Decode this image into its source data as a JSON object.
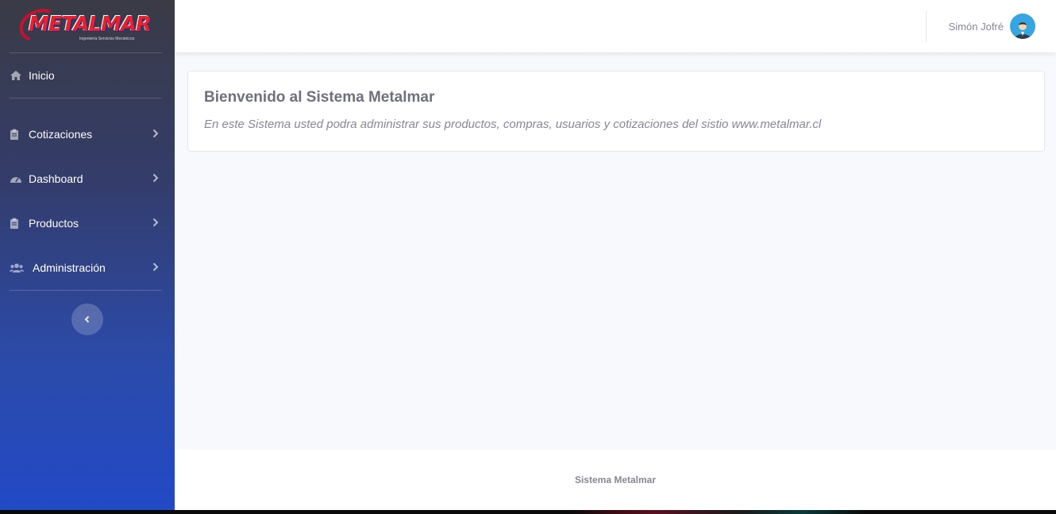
{
  "brand": {
    "logo_text": "METALMAR",
    "logo_subtitle": "Ingeniería Servicios Mecánicos"
  },
  "sidebar": {
    "items": [
      {
        "label": "Inicio",
        "icon": "home-icon"
      },
      {
        "label": "Cotizaciones",
        "icon": "clipboard-icon"
      },
      {
        "label": "Dashboard",
        "icon": "tachometer-icon"
      },
      {
        "label": "Productos",
        "icon": "clipboard-icon"
      },
      {
        "label": "Administración",
        "icon": "users-icon"
      }
    ],
    "toggle_icon": "chevron-left-icon"
  },
  "topbar": {
    "user_name": "Simón Jofré",
    "avatar_icon": "user-avatar-icon"
  },
  "main": {
    "title": "Bienvenido al Sistema Metalmar",
    "subtitle": "En este Sistema usted podra administrar sus productos, compras, usuarios y cotizaciones del sistio www.metalmar.cl"
  },
  "footer": {
    "text": "Sistema Metalmar"
  },
  "colors": {
    "sidebar_top": "#3a3b45",
    "sidebar_bottom": "#2249c6",
    "content_bg": "#f8f9fc",
    "text_gray": "#858796"
  }
}
